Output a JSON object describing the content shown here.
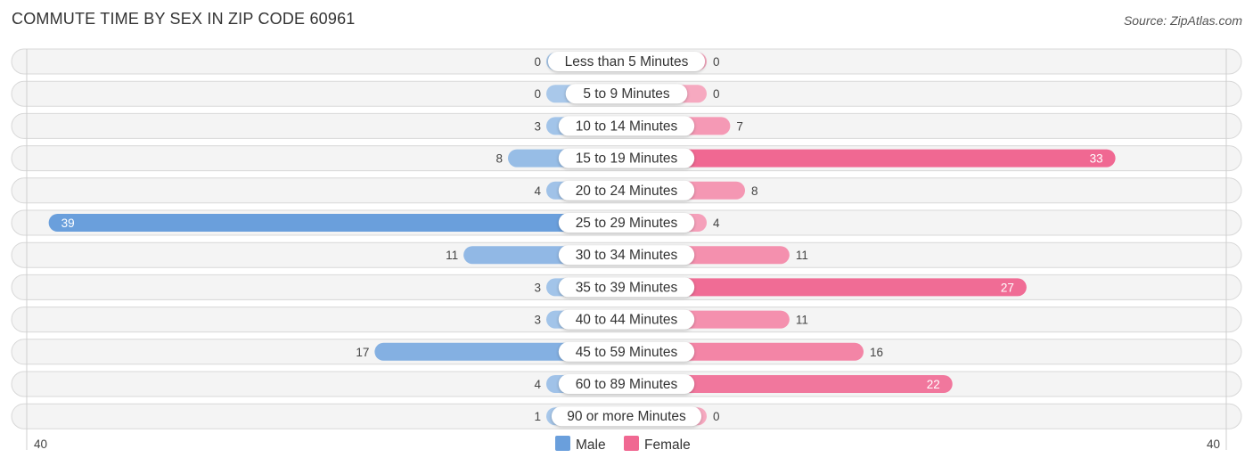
{
  "header": {
    "title": "COMMUTE TIME BY SEX IN ZIP CODE 60961",
    "source": "Source: ZipAtlas.com"
  },
  "colors": {
    "male": "#6a9fdc",
    "male_light": "#a9c8ea",
    "female": "#f06892",
    "female_light": "#f6a9c0",
    "row_bg": "#f4f4f4"
  },
  "chart_data": {
    "type": "bar",
    "orientation": "horizontal-diverging",
    "title": "COMMUTE TIME BY SEX IN ZIP CODE 60961",
    "categories": [
      "Less than 5 Minutes",
      "5 to 9 Minutes",
      "10 to 14 Minutes",
      "15 to 19 Minutes",
      "20 to 24 Minutes",
      "25 to 29 Minutes",
      "30 to 34 Minutes",
      "35 to 39 Minutes",
      "40 to 44 Minutes",
      "45 to 59 Minutes",
      "60 to 89 Minutes",
      "90 or more Minutes"
    ],
    "series": [
      {
        "name": "Male",
        "side": "left",
        "values": [
          0,
          0,
          3,
          8,
          4,
          39,
          11,
          3,
          3,
          17,
          4,
          1
        ]
      },
      {
        "name": "Female",
        "side": "right",
        "values": [
          0,
          0,
          7,
          33,
          8,
          4,
          11,
          27,
          11,
          16,
          22,
          0
        ]
      }
    ],
    "xlim": [
      -40,
      40
    ],
    "axis_labels": {
      "left": "40",
      "right": "40"
    },
    "legend": {
      "placement": "bottom-center",
      "entries": [
        "Male",
        "Female"
      ]
    },
    "grid": false
  }
}
